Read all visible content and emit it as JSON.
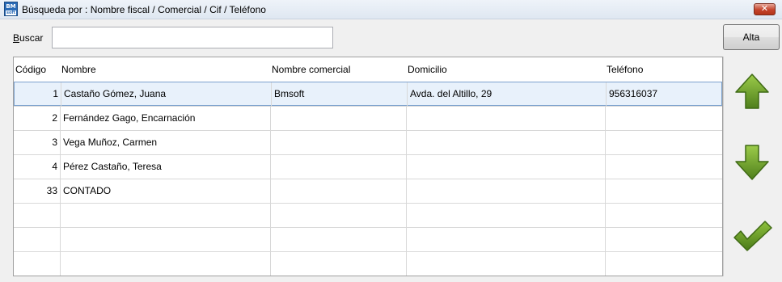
{
  "window": {
    "title": "Búsqueda por : Nombre fiscal / Comercial / Cif / Teléfono",
    "app_icon_top": "BM",
    "app_icon_bottom": "soft",
    "close_label": "✕"
  },
  "search": {
    "label_prefix": "B",
    "label_rest": "uscar",
    "value": "",
    "placeholder": ""
  },
  "toolbar": {
    "alta_label": "Alta"
  },
  "table": {
    "columns": [
      "Código",
      "Nombre",
      "Nombre comercial",
      "Domicilio",
      "Teléfono"
    ],
    "rows": [
      [
        "1",
        "Castaño Gómez, Juana",
        "Bmsoft",
        "Avda. del Altillo, 29",
        "956316037"
      ],
      [
        "2",
        "Fernández Gago, Encarnación",
        "",
        "",
        ""
      ],
      [
        "3",
        "Vega Muñoz, Carmen",
        "",
        "",
        ""
      ],
      [
        "4",
        "Pérez Castaño, Teresa",
        "",
        "",
        ""
      ],
      [
        "33",
        "CONTADO",
        "",
        "",
        ""
      ],
      [
        "",
        "",
        "",
        "",
        ""
      ],
      [
        "",
        "",
        "",
        "",
        ""
      ],
      [
        "",
        "",
        "",
        "",
        ""
      ]
    ],
    "selected_row": 0
  },
  "side_buttons": {
    "up_icon": "arrow-up-icon",
    "down_icon": "arrow-down-icon",
    "accept_icon": "checkmark-icon"
  },
  "colors": {
    "accent_green": "#5a8a22",
    "selection": "#e8f1fb"
  }
}
